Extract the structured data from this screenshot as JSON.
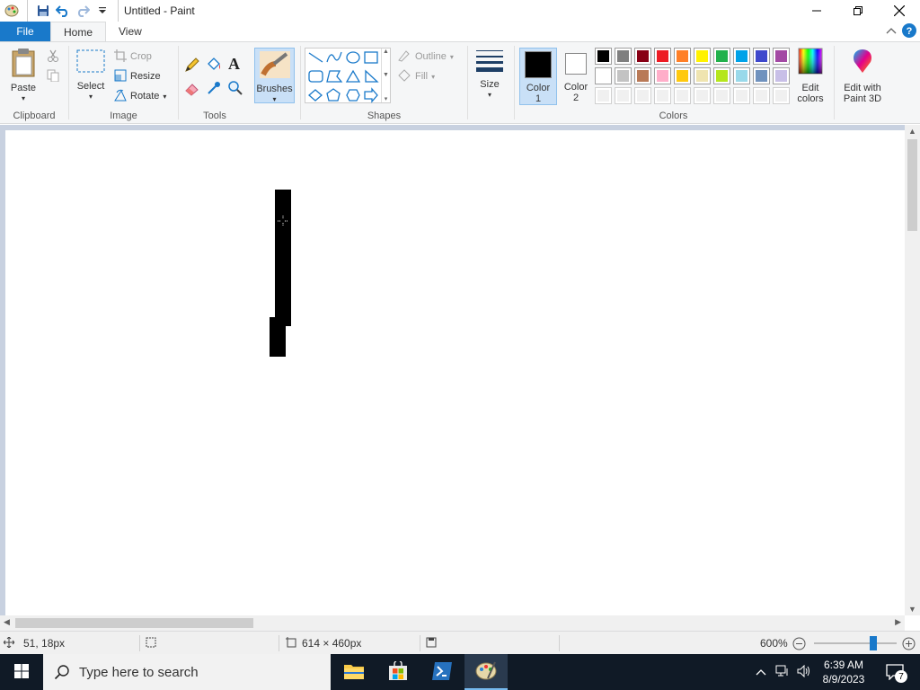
{
  "window": {
    "title": "Untitled - Paint"
  },
  "tabs": {
    "file": "File",
    "home": "Home",
    "view": "View"
  },
  "clipboard": {
    "paste": "Paste",
    "group": "Clipboard"
  },
  "image": {
    "select": "Select",
    "crop": "Crop",
    "resize": "Resize",
    "rotate": "Rotate",
    "group": "Image"
  },
  "tools": {
    "group": "Tools",
    "brushes": "Brushes"
  },
  "shapes": {
    "outline": "Outline",
    "fill": "Fill",
    "group": "Shapes"
  },
  "size": {
    "label": "Size"
  },
  "colors": {
    "color1_line1": "Color",
    "color1_line2": "1",
    "color2_line1": "Color",
    "color2_line2": "2",
    "edit_line1": "Edit",
    "edit_line2": "colors",
    "group": "Colors",
    "color1_value": "#000000",
    "color2_value": "#ffffff",
    "palette_row1": [
      "#000000",
      "#7f7f7f",
      "#880015",
      "#ed1c24",
      "#ff7f27",
      "#fff200",
      "#22b14c",
      "#00a2e8",
      "#3f48cc",
      "#a349a4"
    ],
    "palette_row2": [
      "#ffffff",
      "#c3c3c3",
      "#b97a57",
      "#ffaec9",
      "#ffc90e",
      "#efe4b0",
      "#b5e61d",
      "#99d9ea",
      "#7092be",
      "#c8bfe7"
    ],
    "palette_row3": [
      "#f0f0f0",
      "#f0f0f0",
      "#f0f0f0",
      "#f0f0f0",
      "#f0f0f0",
      "#f0f0f0",
      "#f0f0f0",
      "#f0f0f0",
      "#f0f0f0",
      "#f0f0f0"
    ]
  },
  "paint3d": {
    "line1": "Edit with",
    "line2": "Paint 3D"
  },
  "status": {
    "cursor_pos": "51, 18px",
    "image_size": "614 × 460px",
    "zoom": "600%",
    "zoom_level": 0.72
  },
  "taskbar": {
    "search_placeholder": "Type here to search",
    "time": "6:39 AM",
    "date": "8/9/2023",
    "notifications": "7"
  }
}
